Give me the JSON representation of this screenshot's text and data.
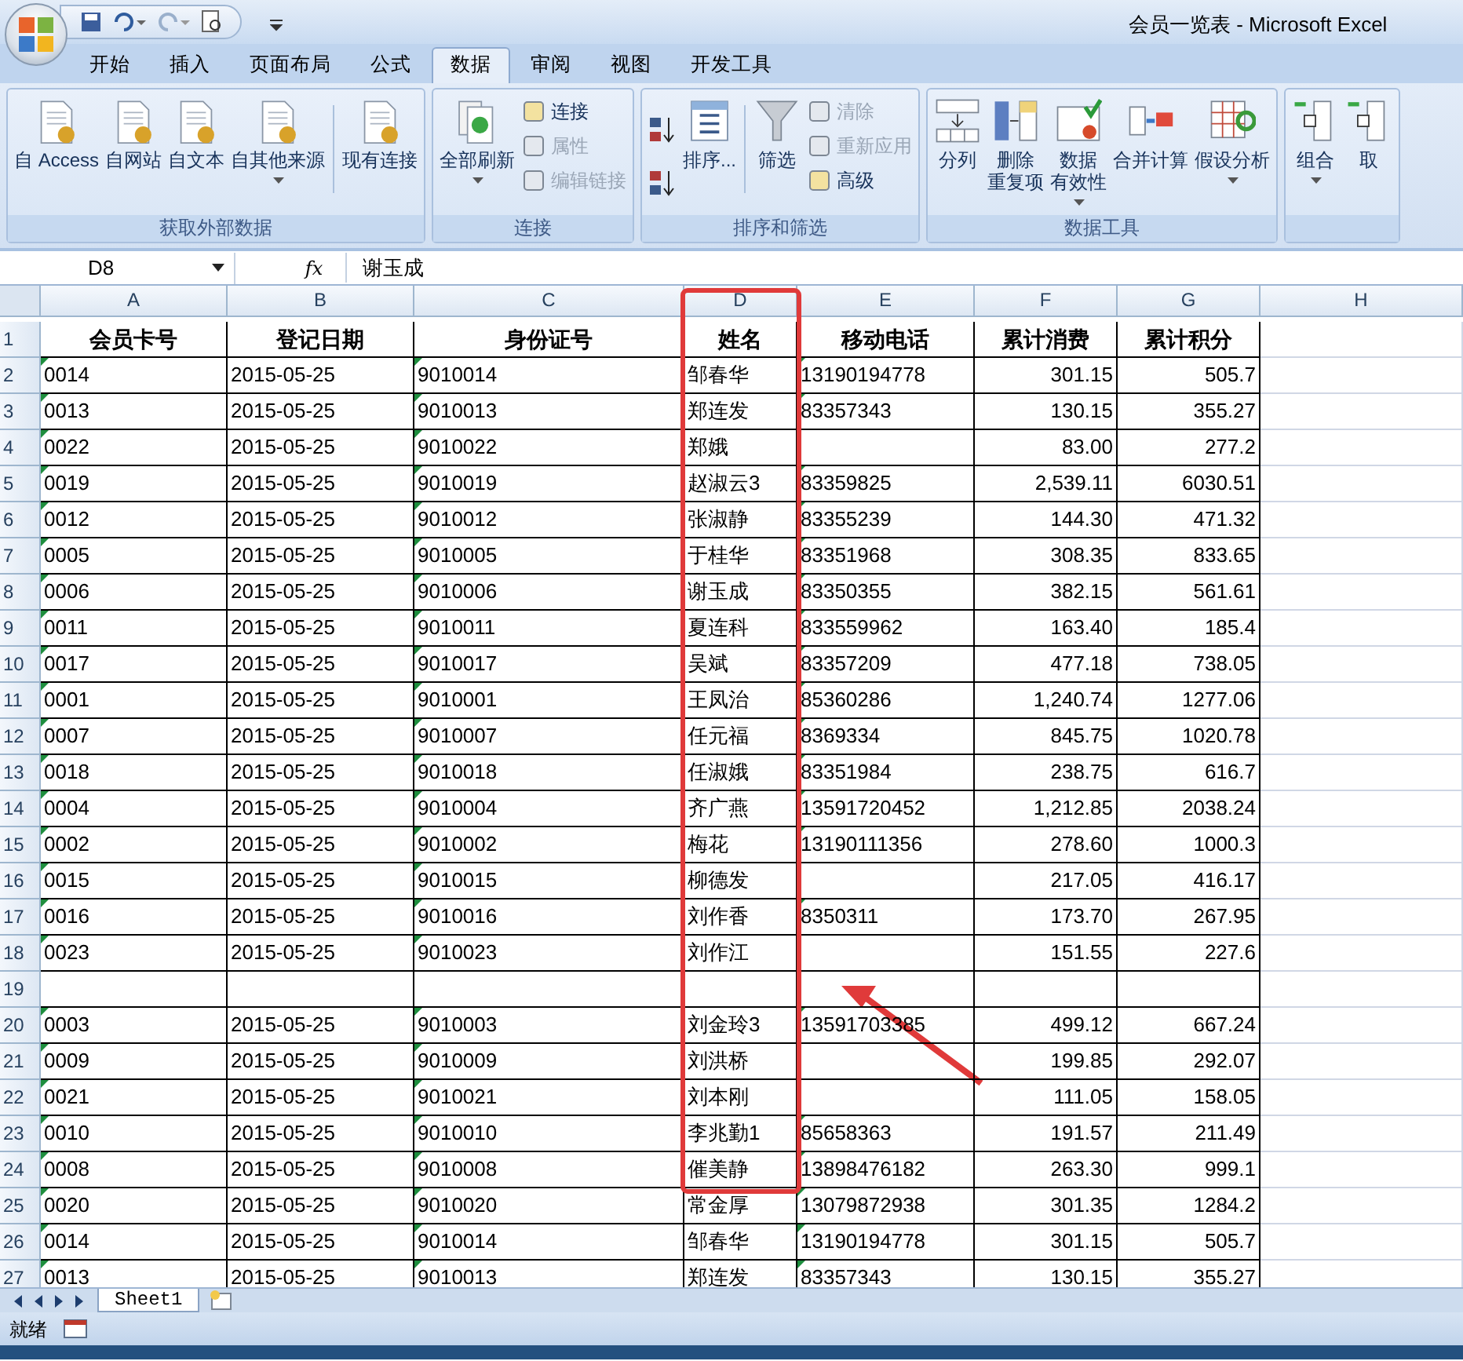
{
  "window": {
    "title": "会员一览表 - Microsoft Excel"
  },
  "tabs": [
    {
      "label": "开始",
      "selected": false
    },
    {
      "label": "插入",
      "selected": false
    },
    {
      "label": "页面布局",
      "selected": false
    },
    {
      "label": "公式",
      "selected": false
    },
    {
      "label": "数据",
      "selected": true
    },
    {
      "label": "审阅",
      "selected": false
    },
    {
      "label": "视图",
      "selected": false
    },
    {
      "label": "开发工具",
      "selected": false
    }
  ],
  "ribbon": {
    "groups": [
      {
        "label": "获取外部数据",
        "items": [
          {
            "kind": "large",
            "label": "自 Access",
            "dropdown": false
          },
          {
            "kind": "large",
            "label": "自网站",
            "dropdown": false
          },
          {
            "kind": "large",
            "label": "自文本",
            "dropdown": false
          },
          {
            "kind": "large",
            "label": "自其他来源",
            "dropdown": true
          },
          {
            "kind": "separator"
          },
          {
            "kind": "large",
            "label": "现有连接",
            "dropdown": false
          }
        ]
      },
      {
        "label": "连接",
        "items": [
          {
            "kind": "large",
            "label": "全部刷新",
            "dropdown": true
          },
          {
            "kind": "stack",
            "items": [
              {
                "label": "连接",
                "disabled": false
              },
              {
                "label": "属性",
                "disabled": true
              },
              {
                "label": "编辑链接",
                "disabled": true
              }
            ]
          }
        ]
      },
      {
        "label": "排序和筛选",
        "items": [
          {
            "kind": "sortpair"
          },
          {
            "kind": "large",
            "label": "排序...",
            "dropdown": false
          },
          {
            "kind": "separator"
          },
          {
            "kind": "large",
            "label": "筛选",
            "dropdown": false
          },
          {
            "kind": "stack",
            "items": [
              {
                "label": "清除",
                "disabled": true
              },
              {
                "label": "重新应用",
                "disabled": true
              },
              {
                "label": "高级",
                "disabled": false
              }
            ]
          }
        ]
      },
      {
        "label": "数据工具",
        "items": [
          {
            "kind": "large",
            "label": "分列",
            "dropdown": false
          },
          {
            "kind": "large",
            "label_lines": [
              "删除",
              "重复项"
            ],
            "dropdown": false
          },
          {
            "kind": "large",
            "label_lines": [
              "数据",
              "有效性"
            ],
            "dropdown": true
          },
          {
            "kind": "large",
            "label": "合并计算",
            "dropdown": false
          },
          {
            "kind": "large",
            "label": "假设分析",
            "dropdown": true
          }
        ]
      },
      {
        "items": [
          {
            "kind": "large",
            "label": "组合",
            "dropdown": true
          },
          {
            "kind": "large",
            "label": "取",
            "dropdown": false
          }
        ]
      }
    ]
  },
  "formula_bar": {
    "name_box": "D8",
    "fx": "fx",
    "formula": "谢玉成"
  },
  "columns": [
    {
      "letter": "A",
      "kind": "textnum"
    },
    {
      "letter": "B",
      "kind": "text"
    },
    {
      "letter": "C",
      "kind": "textnum"
    },
    {
      "letter": "D",
      "kind": "text"
    },
    {
      "letter": "E",
      "kind": "textnum"
    },
    {
      "letter": "F",
      "kind": "number"
    },
    {
      "letter": "G",
      "kind": "number"
    },
    {
      "letter": "H",
      "kind": "text"
    }
  ],
  "rows": [
    {
      "n": "1",
      "kind": "header",
      "cells": [
        "会员卡号",
        "登记日期",
        "身份证号",
        "姓名",
        "移动电话",
        "累计消费",
        "累计积分"
      ]
    },
    {
      "n": "2",
      "cells": [
        "0014",
        "2015-05-25",
        "9010014",
        "邹春华",
        "13190194778",
        "301.15",
        "505.7"
      ]
    },
    {
      "n": "3",
      "cells": [
        "0013",
        "2015-05-25",
        "9010013",
        "郑连发",
        "83357343",
        "130.15",
        "355.27"
      ]
    },
    {
      "n": "4",
      "cells": [
        "0022",
        "2015-05-25",
        "9010022",
        "郑娥",
        null,
        "83.00",
        "277.2"
      ]
    },
    {
      "n": "5",
      "cells": [
        "0019",
        "2015-05-25",
        "9010019",
        "赵淑云3",
        "83359825",
        "2,539.11",
        "6030.51"
      ]
    },
    {
      "n": "6",
      "cells": [
        "0012",
        "2015-05-25",
        "9010012",
        "张淑静",
        "83355239",
        "144.30",
        "471.32"
      ]
    },
    {
      "n": "7",
      "cells": [
        "0005",
        "2015-05-25",
        "9010005",
        "于桂华",
        "83351968",
        "308.35",
        "833.65"
      ]
    },
    {
      "n": "8",
      "cells": [
        "0006",
        "2015-05-25",
        "9010006",
        "谢玉成",
        "83350355",
        "382.15",
        "561.61"
      ]
    },
    {
      "n": "9",
      "cells": [
        "0011",
        "2015-05-25",
        "9010011",
        "夏连科",
        "833559962",
        "163.40",
        "185.4"
      ]
    },
    {
      "n": "10",
      "cells": [
        "0017",
        "2015-05-25",
        "9010017",
        "吴斌",
        "83357209",
        "477.18",
        "738.05"
      ]
    },
    {
      "n": "11",
      "cells": [
        "0001",
        "2015-05-25",
        "9010001",
        "王凤治",
        "85360286",
        "1,240.74",
        "1277.06"
      ]
    },
    {
      "n": "12",
      "cells": [
        "0007",
        "2015-05-25",
        "9010007",
        "任元福",
        "8369334",
        "845.75",
        "1020.78"
      ]
    },
    {
      "n": "13",
      "cells": [
        "0018",
        "2015-05-25",
        "9010018",
        "任淑娥",
        "83351984",
        "238.75",
        "616.7"
      ]
    },
    {
      "n": "14",
      "cells": [
        "0004",
        "2015-05-25",
        "9010004",
        "齐广燕",
        "13591720452",
        "1,212.85",
        "2038.24"
      ]
    },
    {
      "n": "15",
      "cells": [
        "0002",
        "2015-05-25",
        "9010002",
        "梅花",
        "13190111356",
        "278.60",
        "1000.3"
      ]
    },
    {
      "n": "16",
      "cells": [
        "0015",
        "2015-05-25",
        "9010015",
        "柳德发",
        null,
        "217.05",
        "416.17"
      ]
    },
    {
      "n": "17",
      "cells": [
        "0016",
        "2015-05-25",
        "9010016",
        "刘作香",
        "8350311",
        "173.70",
        "267.95"
      ]
    },
    {
      "n": "18",
      "cells": [
        "0023",
        "2015-05-25",
        "9010023",
        "刘作江",
        null,
        "151.55",
        "227.6"
      ]
    },
    {
      "n": "19",
      "cells": [
        null,
        null,
        null,
        null,
        null,
        null,
        null
      ]
    },
    {
      "n": "20",
      "cells": [
        "0003",
        "2015-05-25",
        "9010003",
        "刘金玲3",
        "13591703385",
        "499.12",
        "667.24"
      ]
    },
    {
      "n": "21",
      "cells": [
        "0009",
        "2015-05-25",
        "9010009",
        "刘洪桥",
        null,
        "199.85",
        "292.07"
      ]
    },
    {
      "n": "22",
      "cells": [
        "0021",
        "2015-05-25",
        "9010021",
        "刘本刚",
        null,
        "111.05",
        "158.05"
      ]
    },
    {
      "n": "23",
      "cells": [
        "0010",
        "2015-05-25",
        "9010010",
        "李兆勤1",
        "85658363",
        "191.57",
        "211.49"
      ]
    },
    {
      "n": "24",
      "cells": [
        "0008",
        "2015-05-25",
        "9010008",
        "催美静",
        "13898476182",
        "263.30",
        "999.1"
      ]
    },
    {
      "n": "25",
      "cells": [
        "0020",
        "2015-05-25",
        "9010020",
        "常金厚",
        "13079872938",
        "301.35",
        "1284.2"
      ]
    },
    {
      "n": "26",
      "cells": [
        "0014",
        "2015-05-25",
        "9010014",
        "邹春华",
        "13190194778",
        "301.15",
        "505.7"
      ]
    },
    {
      "n": "27",
      "cells": [
        "0013",
        "2015-05-25",
        "9010013",
        "郑连发",
        "83357343",
        "130.15",
        "355.27"
      ]
    }
  ],
  "annotations": {
    "frame": true,
    "arrow": true
  },
  "sheet_tabs": [
    {
      "label": "Sheet1",
      "selected": true
    }
  ],
  "status_bar": {
    "text": "就绪"
  }
}
